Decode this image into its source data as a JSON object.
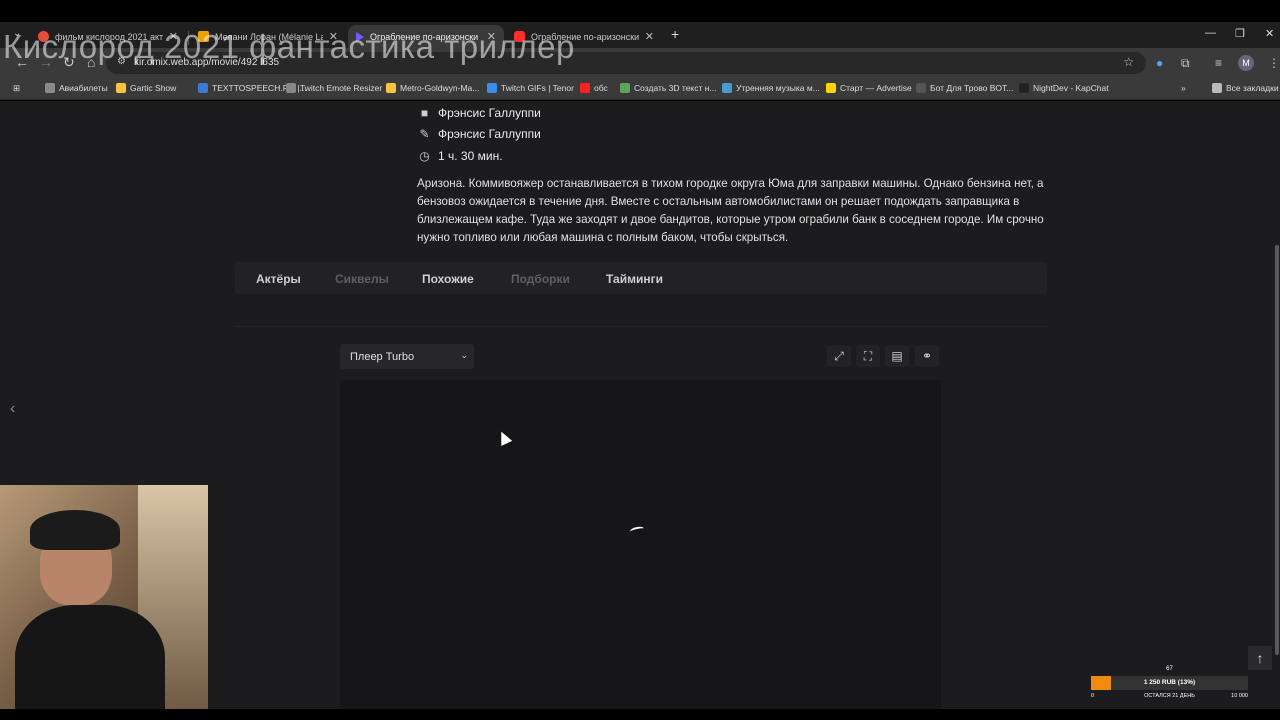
{
  "browser": {
    "tabs": [
      {
        "label": "фильм кислород 2021 актеры",
        "favicon_color": "#e74c3c"
      },
      {
        "label": "Мелани Лоран (Mélanie Laurent)",
        "favicon_color": "#f0a000"
      },
      {
        "label": "Ограбление по-аризонски (2019)",
        "favicon_color": "#6e5cff"
      },
      {
        "label": "Ограбление по-аризонски - Р",
        "favicon_color": "#ff2d2d"
      }
    ],
    "new_tab_icon": "+",
    "url": "kir.omix.web.app/movie/492 l635",
    "bookmarks": [
      {
        "label": "Авиабилеты",
        "color": "#8a8a8a"
      },
      {
        "label": "Gartic Show",
        "color": "#f5c542"
      },
      {
        "label": "TEXTTOSPEECH.RU |...",
        "color": "#3a7bd5"
      },
      {
        "label": "Twitch Emote Resizer",
        "color": "#888888"
      },
      {
        "label": "Metro-Goldwyn-Ma...",
        "color": "#f5c542"
      },
      {
        "label": "Twitch GIFs | Tenor",
        "color": "#3b8ef0"
      },
      {
        "label": "обс",
        "color": "#ff2020"
      },
      {
        "label": "Создать 3D текст н...",
        "color": "#5aa65a"
      },
      {
        "label": "Утренняя музыка м...",
        "color": "#4a9ad0"
      },
      {
        "label": "Старт — Advertise",
        "color": "#ffd400"
      },
      {
        "label": "Бот Для Трово BOT...",
        "color": "#555555"
      },
      {
        "label": "NightDev - KapChat",
        "color": "#222222"
      }
    ],
    "all_bookmarks": "Все закладки",
    "profile_initial": "M"
  },
  "overlay_title": "Кислород 2021 фантастика триллер",
  "movie": {
    "director": "Фрэнсис Галлуппи",
    "writer": "Фрэнсис Галлуппи",
    "duration": "1 ч. 30 мин.",
    "description": "Аризона. Коммивояжер останавливается в тихом городке округа Юма для заправки машины. Однако бензина нет, а бензовоз ожидается в течение дня. Вместе с остальным автомобилистами он решает подождать заправщика в близлежащем кафе. Туда же заходят и двое бандитов, которые утром ограбили банк в соседнем городе. Им срочно нужно топливо или любая машина с полным баком, чтобы скрыться."
  },
  "page_tabs": [
    {
      "label": "Актёры",
      "state": "on"
    },
    {
      "label": "Сиквелы",
      "state": "off"
    },
    {
      "label": "Похожие",
      "state": "on"
    },
    {
      "label": "Подборки",
      "state": "off"
    },
    {
      "label": "Тайминги",
      "state": "on"
    }
  ],
  "player": {
    "selected": "Плеер Turbo",
    "buttons": [
      "expand-icon",
      "fullscreen-icon",
      "comment-icon",
      "link-icon"
    ]
  },
  "donation": {
    "count": "67",
    "amount": "1 250 RUB (13%)",
    "progress": 0.13,
    "min": "0",
    "remaining": "ОСТАЛСЯ 21 ДЕНЬ",
    "max": "10 000",
    "fill_color": "#f08a10"
  }
}
